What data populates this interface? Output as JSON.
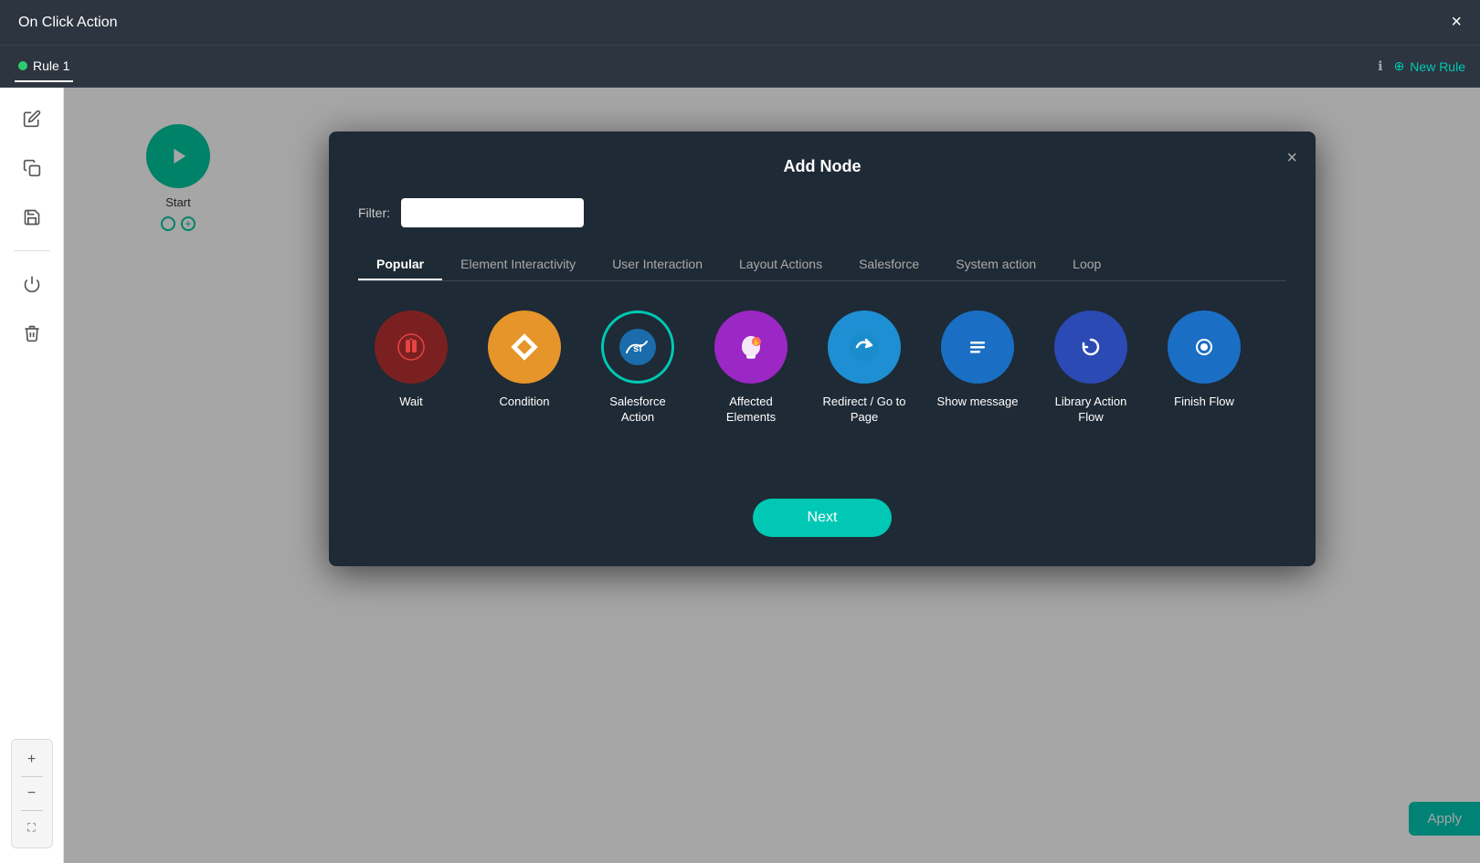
{
  "titleBar": {
    "title": "On Click Action",
    "closeLabel": "×"
  },
  "tabBar": {
    "activeTab": "Rule 1",
    "newRuleLabel": "New Rule",
    "infoIcon": "ℹ"
  },
  "leftToolbar": {
    "buttons": [
      {
        "name": "edit-icon",
        "symbol": "✏",
        "label": "Edit"
      },
      {
        "name": "copy-icon",
        "symbol": "⧉",
        "label": "Copy"
      },
      {
        "name": "save-icon",
        "symbol": "💾",
        "label": "Save"
      },
      {
        "name": "power-icon",
        "symbol": "⏻",
        "label": "Power"
      },
      {
        "name": "delete-icon",
        "symbol": "🗑",
        "label": "Delete"
      }
    ],
    "zoomIn": "+",
    "zoomOut": "−",
    "fitScreen": "⛶"
  },
  "startNode": {
    "label": "Start"
  },
  "applyBtn": "Apply",
  "modal": {
    "title": "Add Node",
    "closeLabel": "×",
    "filter": {
      "label": "Filter:",
      "placeholder": ""
    },
    "tabs": [
      {
        "id": "popular",
        "label": "Popular",
        "active": true
      },
      {
        "id": "element-interactivity",
        "label": "Element Interactivity",
        "active": false
      },
      {
        "id": "user-interaction",
        "label": "User Interaction",
        "active": false
      },
      {
        "id": "layout-actions",
        "label": "Layout Actions",
        "active": false
      },
      {
        "id": "salesforce",
        "label": "Salesforce",
        "active": false
      },
      {
        "id": "system-action",
        "label": "System action",
        "active": false
      },
      {
        "id": "loop",
        "label": "Loop",
        "active": false
      }
    ],
    "nodes": [
      {
        "id": "wait",
        "label": "Wait",
        "iconColor": "icon-wait",
        "symbol": "⏳"
      },
      {
        "id": "condition",
        "label": "Condition",
        "iconColor": "icon-condition",
        "symbol": "◇"
      },
      {
        "id": "salesforce-action",
        "label": "Salesforce Action",
        "iconColor": "icon-salesforce",
        "symbol": "sf"
      },
      {
        "id": "affected-elements",
        "label": "Affected Elements",
        "iconColor": "icon-affected",
        "symbol": "✋"
      },
      {
        "id": "redirect",
        "label": "Redirect / Go to Page",
        "iconColor": "icon-redirect",
        "symbol": "↪"
      },
      {
        "id": "show-message",
        "label": "Show message",
        "iconColor": "icon-showmsg",
        "symbol": "≡"
      },
      {
        "id": "library-action-flow",
        "label": "Library Action Flow",
        "iconColor": "icon-library",
        "symbol": "↻"
      },
      {
        "id": "finish-flow",
        "label": "Finish Flow",
        "iconColor": "icon-finishflow",
        "symbol": "⊙"
      }
    ],
    "nextBtn": "Next"
  }
}
